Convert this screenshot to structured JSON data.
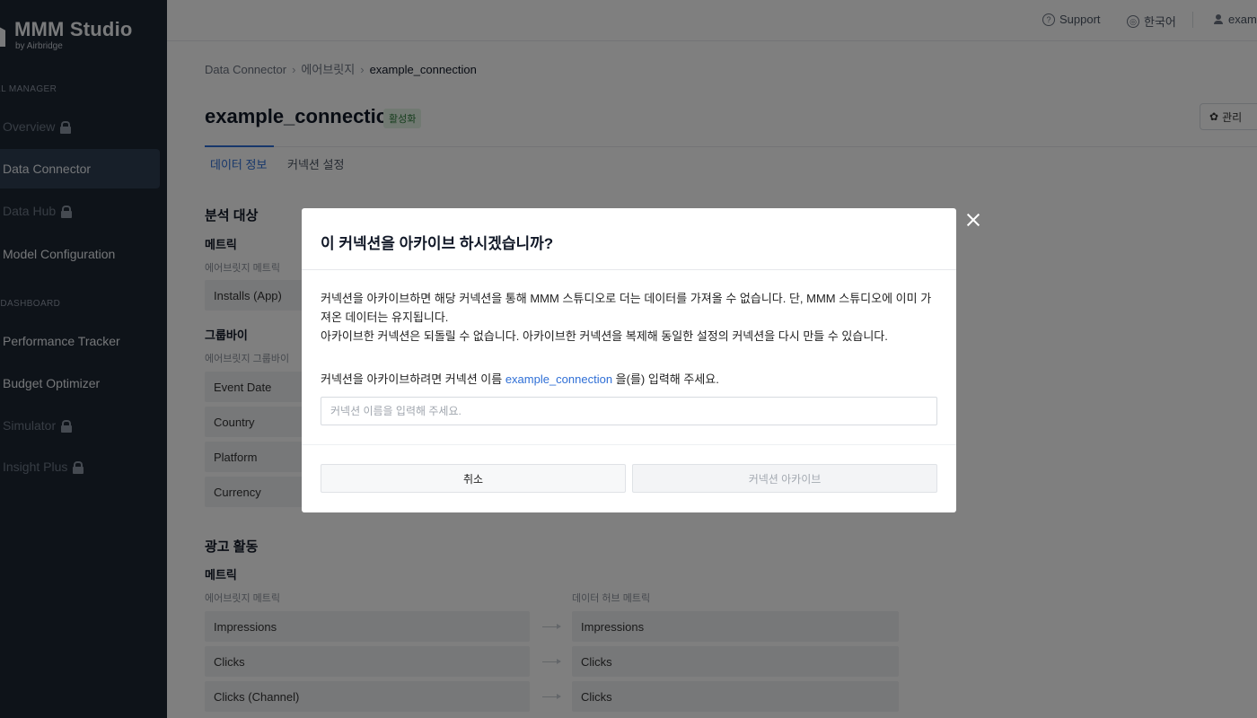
{
  "brand": {
    "title": "MMM Studio",
    "subtitle": "by Airbridge"
  },
  "sidebar": {
    "section1": "EL MANAGER",
    "section2": "I DASHBOARD",
    "items": [
      {
        "label": "Overview"
      },
      {
        "label": "Data Connector"
      },
      {
        "label": "Data Hub"
      },
      {
        "label": "Model Configuration"
      },
      {
        "label": "Performance Tracker"
      },
      {
        "label": "Budget Optimizer"
      },
      {
        "label": "Simulator"
      },
      {
        "label": "Insight Plus"
      }
    ]
  },
  "topbar": {
    "support": "Support",
    "language": "한국어",
    "user": "exam"
  },
  "breadcrumb": [
    "Data Connector",
    "에어브릿지",
    "example_connection"
  ],
  "page": {
    "title": "example_connection",
    "status": "활성화",
    "manage": "관리",
    "tabs": [
      "데이터 정보",
      "커넥션 설정"
    ]
  },
  "analysis": {
    "heading": "분석 대상",
    "metric_label": "메트릭",
    "metric_caption": "에어브릿지 메트릭",
    "metric_cell": "Installs (App)",
    "groupby_label": "그룹바이",
    "groupby_caption": "에어브릿지 그룹바이",
    "groupby_cells": [
      "Event Date",
      "Country",
      "Platform",
      "Currency"
    ]
  },
  "ads": {
    "heading": "광고 활동",
    "metric_label": "메트릭",
    "left_caption": "에어브릿지 메트릭",
    "right_caption": "데이터 허브 메트릭",
    "rows": [
      {
        "left": "Impressions",
        "right": "Impressions"
      },
      {
        "left": "Clicks",
        "right": "Clicks"
      },
      {
        "left": "Clicks (Channel)",
        "right": "Clicks"
      }
    ]
  },
  "modal": {
    "title": "이 커넥션을 아카이브 하시겠습니까?",
    "body_line1": "커넥션을 아카이브하면 해당 커넥션을 통해 MMM 스튜디오로 더는 데이터를 가져올 수 없습니다. 단, MMM 스튜디오에 이미 가져온 데이터는 유지됩니다.",
    "body_line2": "아카이브한 커넥션은 되돌릴 수 없습니다. 아카이브한 커넥션을 복제해 동일한 설정의 커넥션을 다시 만들 수 있습니다.",
    "prompt_before": "커넥션을 아카이브하려면 커넥션 이름 ",
    "prompt_link": "example_connection",
    "prompt_after": " 을(를) 입력해 주세요.",
    "input_placeholder": "커넥션 이름을 입력해 주세요.",
    "input_value": "",
    "cancel": "취소",
    "confirm": "커넥션 아카이브"
  }
}
